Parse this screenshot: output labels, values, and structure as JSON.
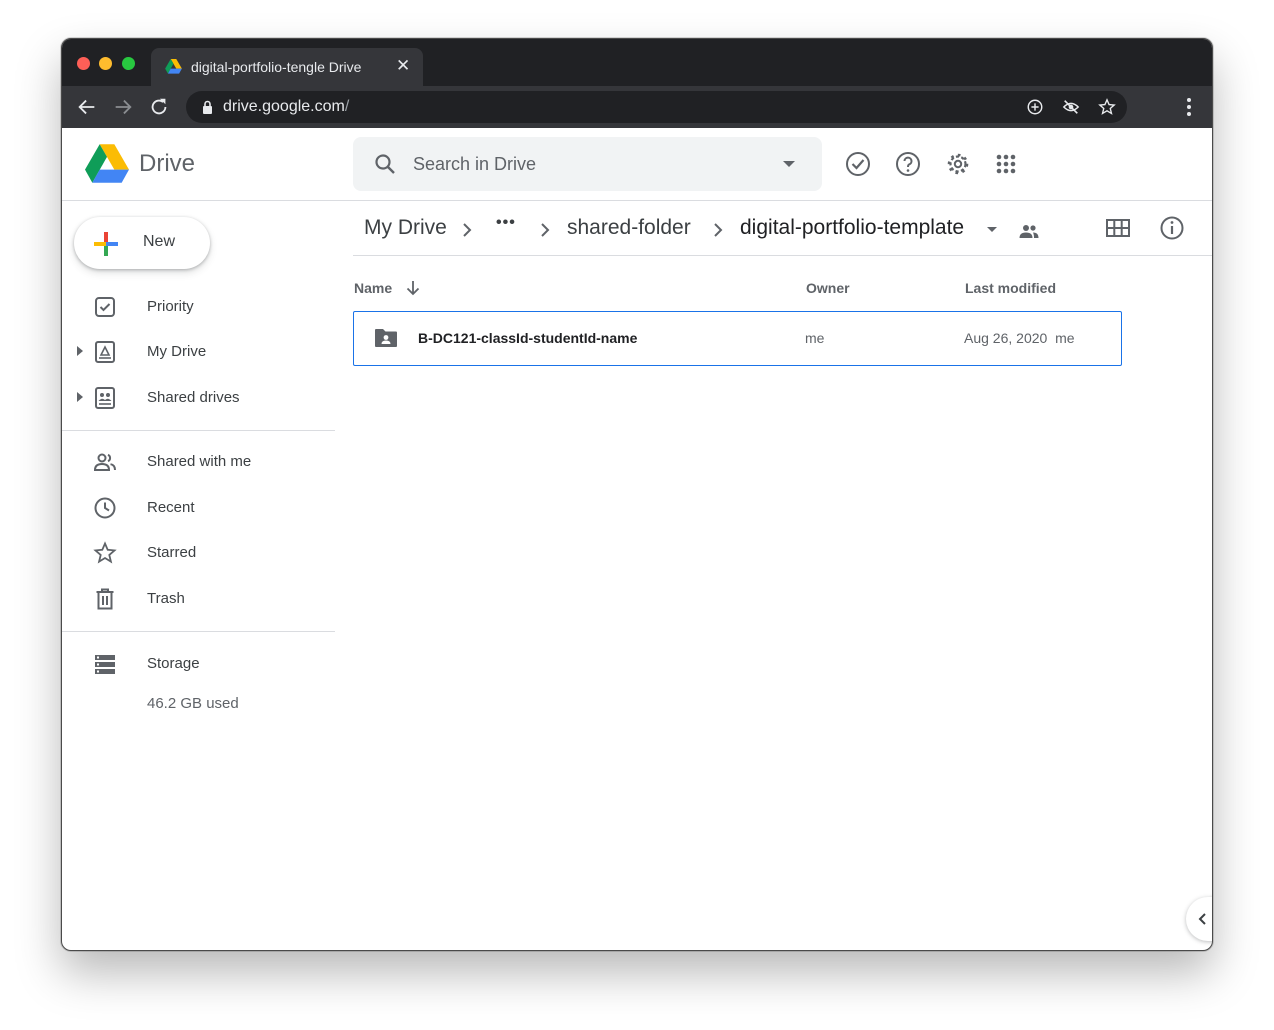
{
  "browser": {
    "tab_title": "digital-portfolio-tengle Drive",
    "url_host": "drive.google.com",
    "url_path": "/"
  },
  "header": {
    "app_name": "Drive",
    "search_placeholder": "Search in Drive"
  },
  "sidebar": {
    "new_label": "New",
    "items": [
      {
        "label": "Priority",
        "icon": "priority-icon"
      },
      {
        "label": "My Drive",
        "icon": "my-drive-icon"
      },
      {
        "label": "Shared drives",
        "icon": "shared-drives-icon"
      },
      {
        "label": "Shared with me",
        "icon": "people-icon"
      },
      {
        "label": "Recent",
        "icon": "clock-icon"
      },
      {
        "label": "Starred",
        "icon": "star-icon"
      },
      {
        "label": "Trash",
        "icon": "trash-icon"
      }
    ],
    "storage_label": "Storage",
    "storage_used": "46.2 GB used"
  },
  "breadcrumb": {
    "root": "My Drive",
    "ellipsis": "•••",
    "parent": "shared-folder",
    "current": "digital-portfolio-template"
  },
  "columns": {
    "name": "Name",
    "owner": "Owner",
    "last_modified": "Last modified"
  },
  "files": [
    {
      "name": "B-DC121-classId-studentId-name",
      "owner": "me",
      "last_modified": "Aug 26, 2020  me",
      "type": "shared-folder"
    }
  ],
  "colors": {
    "accent": "#1a73e8",
    "chrome_dark": "#202124",
    "chrome_toolbar": "#35363a"
  }
}
